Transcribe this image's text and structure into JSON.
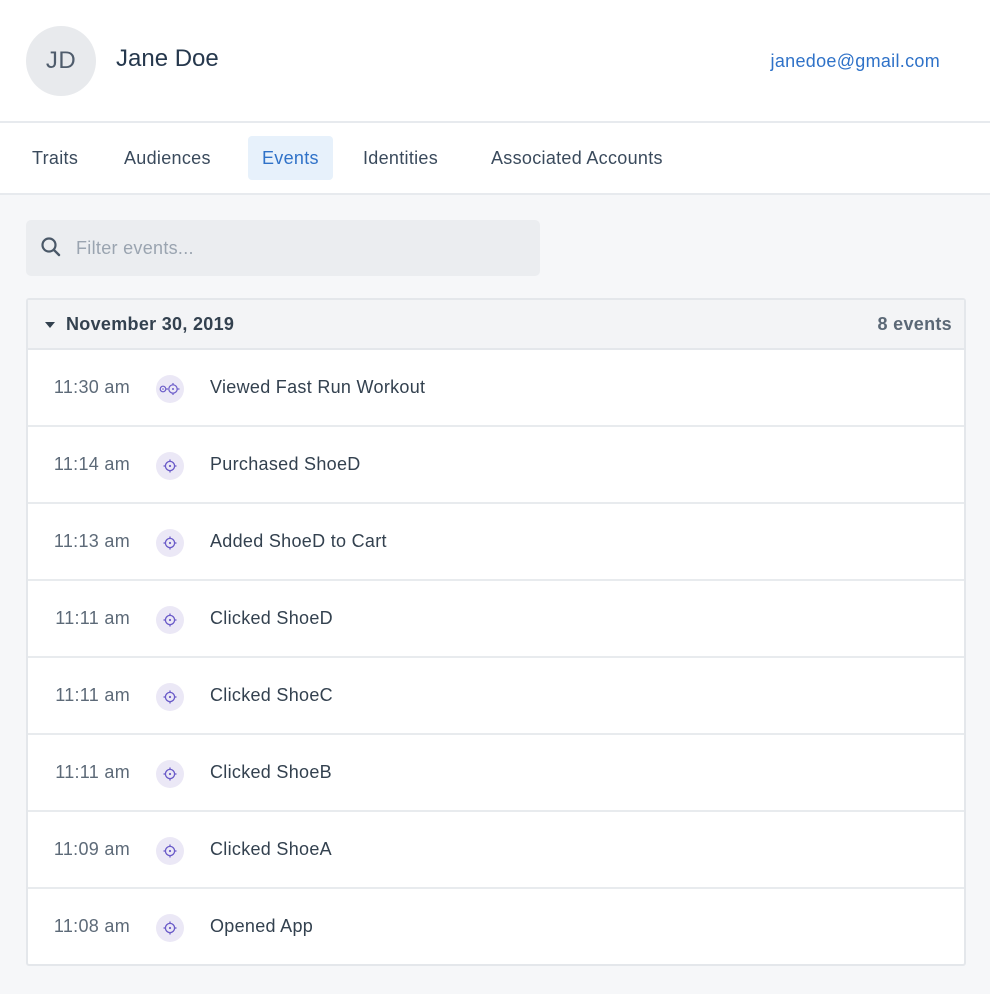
{
  "user": {
    "initials": "JD",
    "name": "Jane Doe",
    "email": "janedoe@gmail.com"
  },
  "tabs": [
    {
      "label": "Traits",
      "active": false
    },
    {
      "label": "Audiences",
      "active": false
    },
    {
      "label": "Events",
      "active": true
    },
    {
      "label": "Identities",
      "active": false
    },
    {
      "label": "Associated Accounts",
      "active": false
    }
  ],
  "search": {
    "placeholder": "Filter events...",
    "value": "",
    "icon": "search-icon"
  },
  "event_group": {
    "date": "November 30, 2019",
    "count_label": "8 events",
    "expanded": true,
    "events": [
      {
        "time": "11:30 am",
        "name": "Viewed Fast Run Workout",
        "icon": "page-view-icon"
      },
      {
        "time": "11:14 am",
        "name": "Purchased ShoeD",
        "icon": "track-event-icon"
      },
      {
        "time": "11:13 am",
        "name": "Added ShoeD to Cart",
        "icon": "track-event-icon"
      },
      {
        "time": "11:11 am",
        "name": "Clicked ShoeD",
        "icon": "track-event-icon"
      },
      {
        "time": "11:11 am",
        "name": "Clicked ShoeC",
        "icon": "track-event-icon"
      },
      {
        "time": "11:11 am",
        "name": "Clicked ShoeB",
        "icon": "track-event-icon"
      },
      {
        "time": "11:09 am",
        "name": "Clicked ShoeA",
        "icon": "track-event-icon"
      },
      {
        "time": "11:08 am",
        "name": "Opened App",
        "icon": "track-event-icon"
      }
    ]
  },
  "colors": {
    "accent": "#2f72c8",
    "active_tab_bg": "#e7f1fb",
    "icon_purple": "#6b5cc9",
    "icon_bg": "#ebe8f6"
  }
}
